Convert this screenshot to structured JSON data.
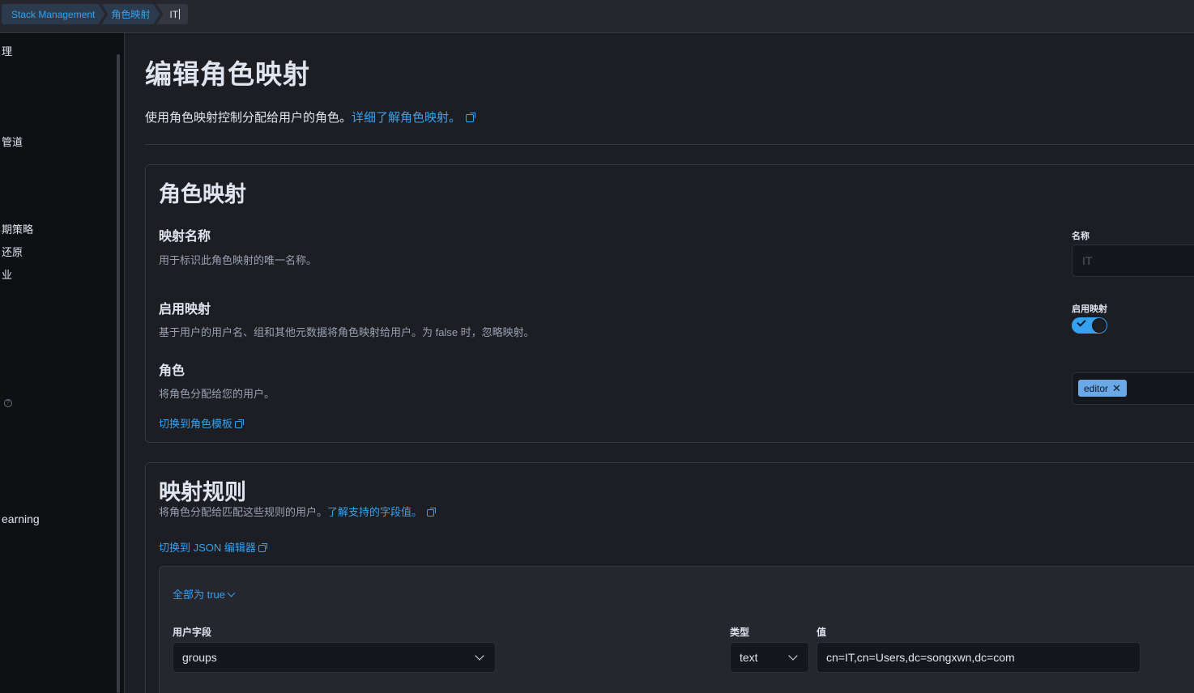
{
  "breadcrumbs": [
    "Stack Management",
    "角色映射",
    "IT"
  ],
  "sidenav": {
    "items": [
      "理",
      "管道",
      "期策略",
      "还原",
      "业",
      "earning"
    ]
  },
  "page": {
    "title": "编辑角色映射",
    "description": "使用角色映射控制分配给用户的角色。",
    "learn_link": "详细了解角色映射。"
  },
  "role_mapping_panel": {
    "title": "角色映射",
    "name_field": {
      "title": "映射名称",
      "description": "用于标识此角色映射的唯一名称。",
      "label": "名称",
      "value": "IT"
    },
    "enabled_field": {
      "title": "启用映射",
      "description": "基于用户的用户名、组和其他元数据将角色映射给用户。为 false 时，忽略映射。",
      "label": "启用映射",
      "enabled": true
    },
    "roles_field": {
      "title": "角色",
      "description": "将角色分配给您的用户。",
      "switch_link": "切换到角色模板",
      "selected_role": "editor"
    }
  },
  "mapping_rules_panel": {
    "title": "映射规则",
    "description": "将角色分配给匹配这些规则的用户。",
    "learn_link": "了解支持的字段值。",
    "json_link": "切换到 JSON 编辑器",
    "all_true": "全部为 true",
    "rule": {
      "user_field_label": "用户字段",
      "user_field_value": "groups",
      "type_label": "类型",
      "type_value": "text",
      "value_label": "值",
      "value": "cn=IT,cn=Users,dc=songxwn,dc=com"
    }
  },
  "colors": {
    "accent": "#36a2ef",
    "background": "#1d1e24",
    "sidebar": "#0f1014",
    "pill": "#6aa8e6"
  }
}
